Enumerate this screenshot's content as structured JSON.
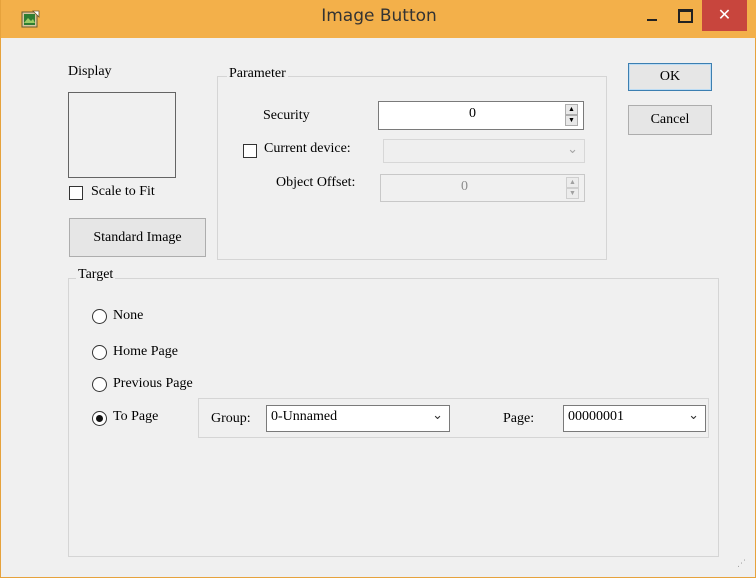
{
  "window": {
    "title": "Image Button",
    "close_glyph": "✕"
  },
  "display": {
    "label": "Display",
    "scale_to_fit_label": "Scale to Fit",
    "scale_to_fit_checked": false,
    "standard_image_label": "Standard Image"
  },
  "parameter": {
    "caption": "Parameter",
    "security_label": "Security",
    "security_value": "0",
    "current_device_label": "Current device:",
    "current_device_checked": false,
    "current_device_value": "",
    "object_offset_label": "Object Offset:",
    "object_offset_value": "0"
  },
  "buttons": {
    "ok_label": "OK",
    "cancel_label": "Cancel"
  },
  "target": {
    "caption": "Target",
    "options": [
      "None",
      "Home Page",
      "Previous Page",
      "To Page"
    ],
    "selected": "To Page",
    "group_label": "Group:",
    "group_value": "0-Unnamed",
    "page_label": "Page:",
    "page_value": "00000001"
  },
  "icons": {
    "app": "image-button-icon",
    "minimize": "minimize-icon",
    "maximize": "maximize-icon",
    "close": "close-icon",
    "dropdown": "chevron-down-icon"
  },
  "colors": {
    "titlebar": "#f3b04a",
    "close_button": "#c8453d",
    "dialog_bg": "#f0f0f0"
  }
}
